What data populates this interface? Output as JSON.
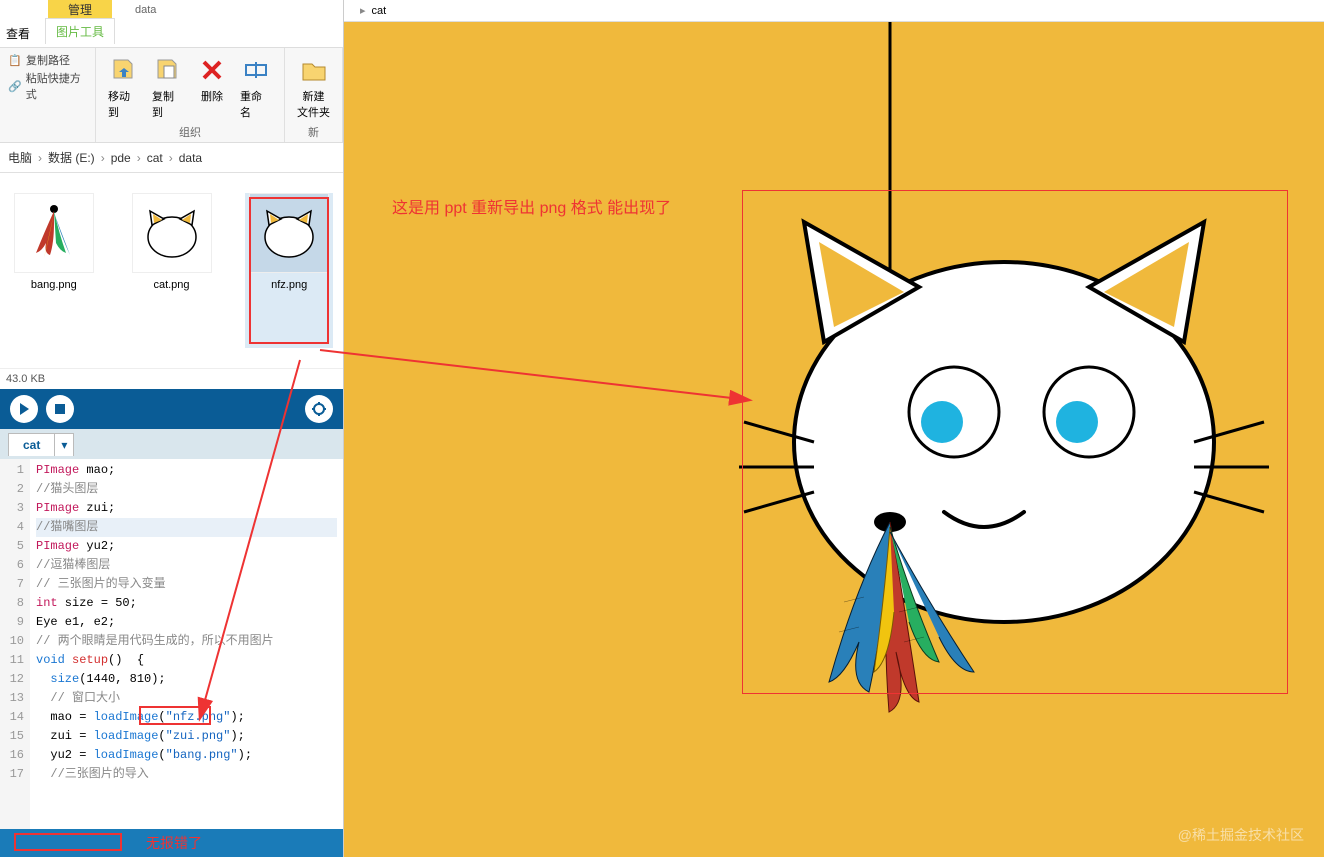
{
  "ribbon_tabs": {
    "view": "查看",
    "context": "管理",
    "tool": "图片工具",
    "data": "data"
  },
  "ribbon": {
    "copy_path": "复制路径",
    "paste_shortcut": "粘贴快捷方式",
    "move_to": "移动到",
    "copy_to": "复制到",
    "delete": "删除",
    "rename": "重命名",
    "organize": "组织",
    "new_folder": "新建\n文件夹",
    "new_group": "新"
  },
  "breadcrumb": {
    "items": [
      "电脑",
      "数据 (E:)",
      "pde",
      "cat",
      "data"
    ]
  },
  "files": [
    {
      "name": "bang.png"
    },
    {
      "name": "cat.png"
    },
    {
      "name": "nfz.png"
    }
  ],
  "status": {
    "size": "43.0 KB"
  },
  "ide": {
    "tab": "cat",
    "lines": [
      {
        "n": 1,
        "html": "<span class='kw-type'>PImage</span> mao;"
      },
      {
        "n": 2,
        "html": "<span class='kw-cmt'>//猫头图层</span>"
      },
      {
        "n": 3,
        "html": "<span class='kw-type'>PImage</span> zui;"
      },
      {
        "n": 4,
        "html": "<span class='kw-cmt'>//猫嘴图层</span>",
        "hl": true
      },
      {
        "n": 5,
        "html": "<span class='kw-type'>PImage</span> yu2;"
      },
      {
        "n": 6,
        "html": "<span class='kw-cmt'>//逗猫棒图层</span>"
      },
      {
        "n": 7,
        "html": "<span class='kw-cmt'>// 三张图片的导入变量</span>"
      },
      {
        "n": 8,
        "html": "<span class='kw-type'>int</span> size = 50;"
      },
      {
        "n": 9,
        "html": "Eye e1, e2;"
      },
      {
        "n": 10,
        "html": "<span class='kw-cmt'>// 两个眼睛是用代码生成的，所以不用图片</span>"
      },
      {
        "n": 11,
        "html": "<span class='kw-void'>void</span> <span class='kw-fn'>setup</span>()  {"
      },
      {
        "n": 12,
        "html": "  <span class='kw-func'>size</span>(1440, 810);"
      },
      {
        "n": 13,
        "html": "  <span class='kw-cmt'>// 窗口大小</span>"
      },
      {
        "n": 14,
        "html": "  mao = <span class='kw-func'>loadImage</span>(<span class='kw-str'>\"nfz.png\"</span>);"
      },
      {
        "n": 15,
        "html": "  zui = <span class='kw-func'>loadImage</span>(<span class='kw-str'>\"zui.png\"</span>);"
      },
      {
        "n": 16,
        "html": "  yu2 = <span class='kw-func'>loadImage</span>(<span class='kw-str'>\"bang.png\"</span>);"
      },
      {
        "n": 17,
        "html": "  <span class='kw-cmt'>//三张图片的导入</span>"
      }
    ],
    "no_error": "无报错了"
  },
  "preview": {
    "title": "cat"
  },
  "annotations": {
    "export_note": "这是用 ppt 重新导出 png 格式 能出现了",
    "watermark": "@稀土掘金技术社区"
  }
}
